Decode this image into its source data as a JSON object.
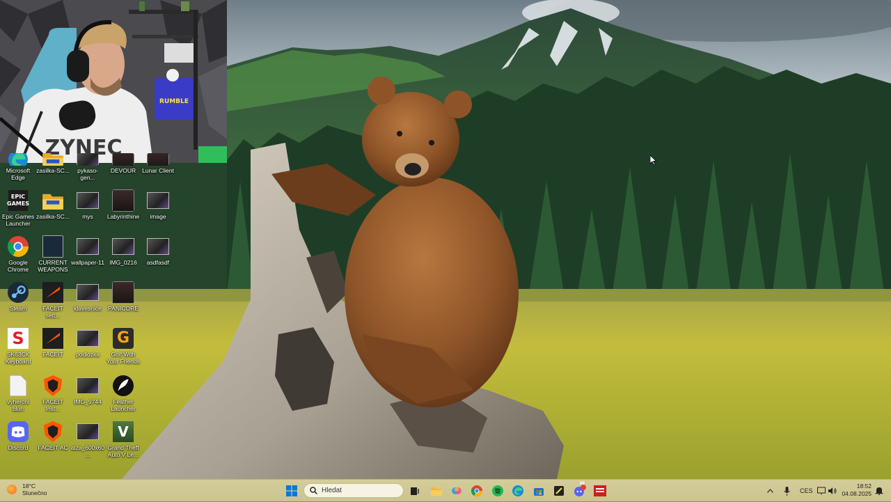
{
  "desktop": {
    "icons": [
      {
        "label": "Microsoft Edge",
        "icon": "edge-icon"
      },
      {
        "label": "zasilka-SC...",
        "icon": "folder-icon"
      },
      {
        "label": "pykaso-gen...",
        "icon": "image-icon"
      },
      {
        "label": "DEVOUR",
        "icon": "game-icon"
      },
      {
        "label": "Lunar Client",
        "icon": "game-icon"
      },
      {
        "label": "Epic Games Launcher",
        "icon": "epic-games-icon"
      },
      {
        "label": "zasilka-SC...",
        "icon": "folder-icon"
      },
      {
        "label": "mys",
        "icon": "image-icon"
      },
      {
        "label": "Labyrinthine",
        "icon": "game-icon"
      },
      {
        "label": "image",
        "icon": "image-icon"
      },
      {
        "label": "Google Chrome",
        "icon": "chrome-icon"
      },
      {
        "label": "CURRENT WEAPONS",
        "icon": "file-icon"
      },
      {
        "label": "wallpaper-11",
        "icon": "image-icon"
      },
      {
        "label": "IMG_0216",
        "icon": "image-icon"
      },
      {
        "label": "asdfasdf",
        "icon": "image-icon"
      },
      {
        "label": "Steam",
        "icon": "steam-icon"
      },
      {
        "label": "FACEIT sett...",
        "icon": "faceit-icon"
      },
      {
        "label": "klavesnice",
        "icon": "image-icon"
      },
      {
        "label": "PANICORE",
        "icon": "game-icon"
      },
      {
        "label": "SK63CK Keyboard",
        "icon": "keyboard-app-icon"
      },
      {
        "label": "FACEIT",
        "icon": "faceit-icon"
      },
      {
        "label": "podlozka",
        "icon": "image-icon"
      },
      {
        "label": "Golf With Your Friends",
        "icon": "golf-icon"
      },
      {
        "label": "vyhercni bluh",
        "icon": "document-icon"
      },
      {
        "label": "FACEIT Inst...",
        "icon": "faceit-ac-icon"
      },
      {
        "label": "IMG_9744",
        "icon": "image-icon"
      },
      {
        "label": "Feather Launcher",
        "icon": "feather-icon"
      },
      {
        "label": "Discord",
        "icon": "discord-icon"
      },
      {
        "label": "FACEIT AC",
        "icon": "faceit-ac-icon"
      },
      {
        "label": "alza_600x60...",
        "icon": "image-icon"
      },
      {
        "label": "Grand Theft Auto V Le...",
        "icon": "gta-icon"
      }
    ]
  },
  "webcam": {
    "shirt_text": "ZYNEC",
    "box_text": "RUMBLE"
  },
  "taskbar": {
    "weather_temp": "18°C",
    "weather_desc": "Slunečno",
    "search_placeholder": "Hledat",
    "language": "CES",
    "time": "18:52",
    "date": "04.08.2025",
    "notification_badge": "99"
  },
  "colors": {
    "taskbar": "#cfc893",
    "sky": "#b9c3c9",
    "forest": "#25462c",
    "meadow": "#b8b33d"
  }
}
